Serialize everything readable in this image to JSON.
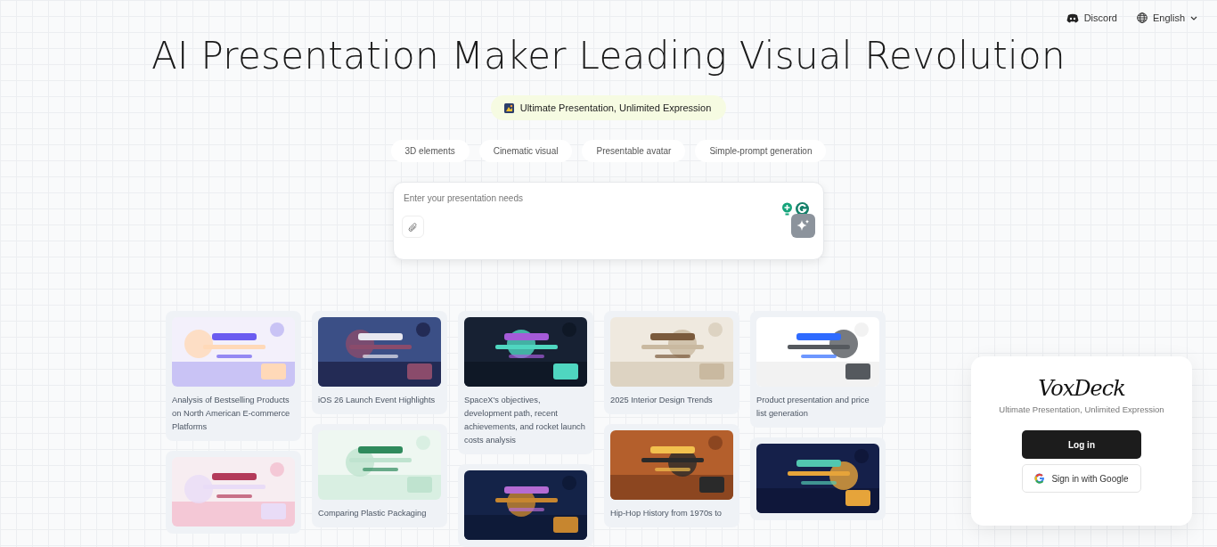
{
  "top_bar": {
    "links": [
      {
        "kind": "discord",
        "label": "Discord"
      },
      {
        "kind": "language",
        "label": "English"
      }
    ]
  },
  "hero": {
    "title": "AI Presentation Maker Leading Visual Revolution",
    "badge": "Ultimate Presentation, Unlimited Expression",
    "chips": [
      "3D elements",
      "Cinematic visual",
      "Presentable avatar",
      "Simple-prompt generation"
    ]
  },
  "prompt": {
    "placeholder": "Enter your presentation needs"
  },
  "gallery": {
    "columns": [
      {
        "cards": [
          {
            "kind": "picture",
            "title": "Analysis of Bestselling Products on North American E-commerce Platforms"
          },
          {
            "kind": "picture"
          }
        ]
      },
      {
        "cards": [
          {
            "kind": "picture",
            "title": "iOS 26 Launch Event Highlights"
          },
          {
            "kind": "picture",
            "title": "Comparing Plastic Packaging"
          }
        ]
      },
      {
        "cards": [
          {
            "kind": "picture",
            "title": "SpaceX's objectives, development path, recent achievements, and rocket launch costs analysis"
          },
          {
            "kind": "picture"
          }
        ]
      },
      {
        "cards": [
          {
            "kind": "picture",
            "title": "2025 Interior Design Trends"
          },
          {
            "kind": "picture",
            "title": "Hip-Hop History from 1970s to"
          }
        ]
      },
      {
        "cards": [
          {
            "kind": "picture",
            "title": "Product presentation and price list generation"
          },
          {
            "kind": "picture"
          }
        ]
      }
    ]
  },
  "login": {
    "logo": "VoxDeck",
    "tagline": "Ultimate Presentation, Unlimited Expression",
    "buttons": [
      {
        "kind": "primary",
        "label": "Log in"
      },
      {
        "kind": "google",
        "label": "Sign in with Google"
      }
    ]
  }
}
